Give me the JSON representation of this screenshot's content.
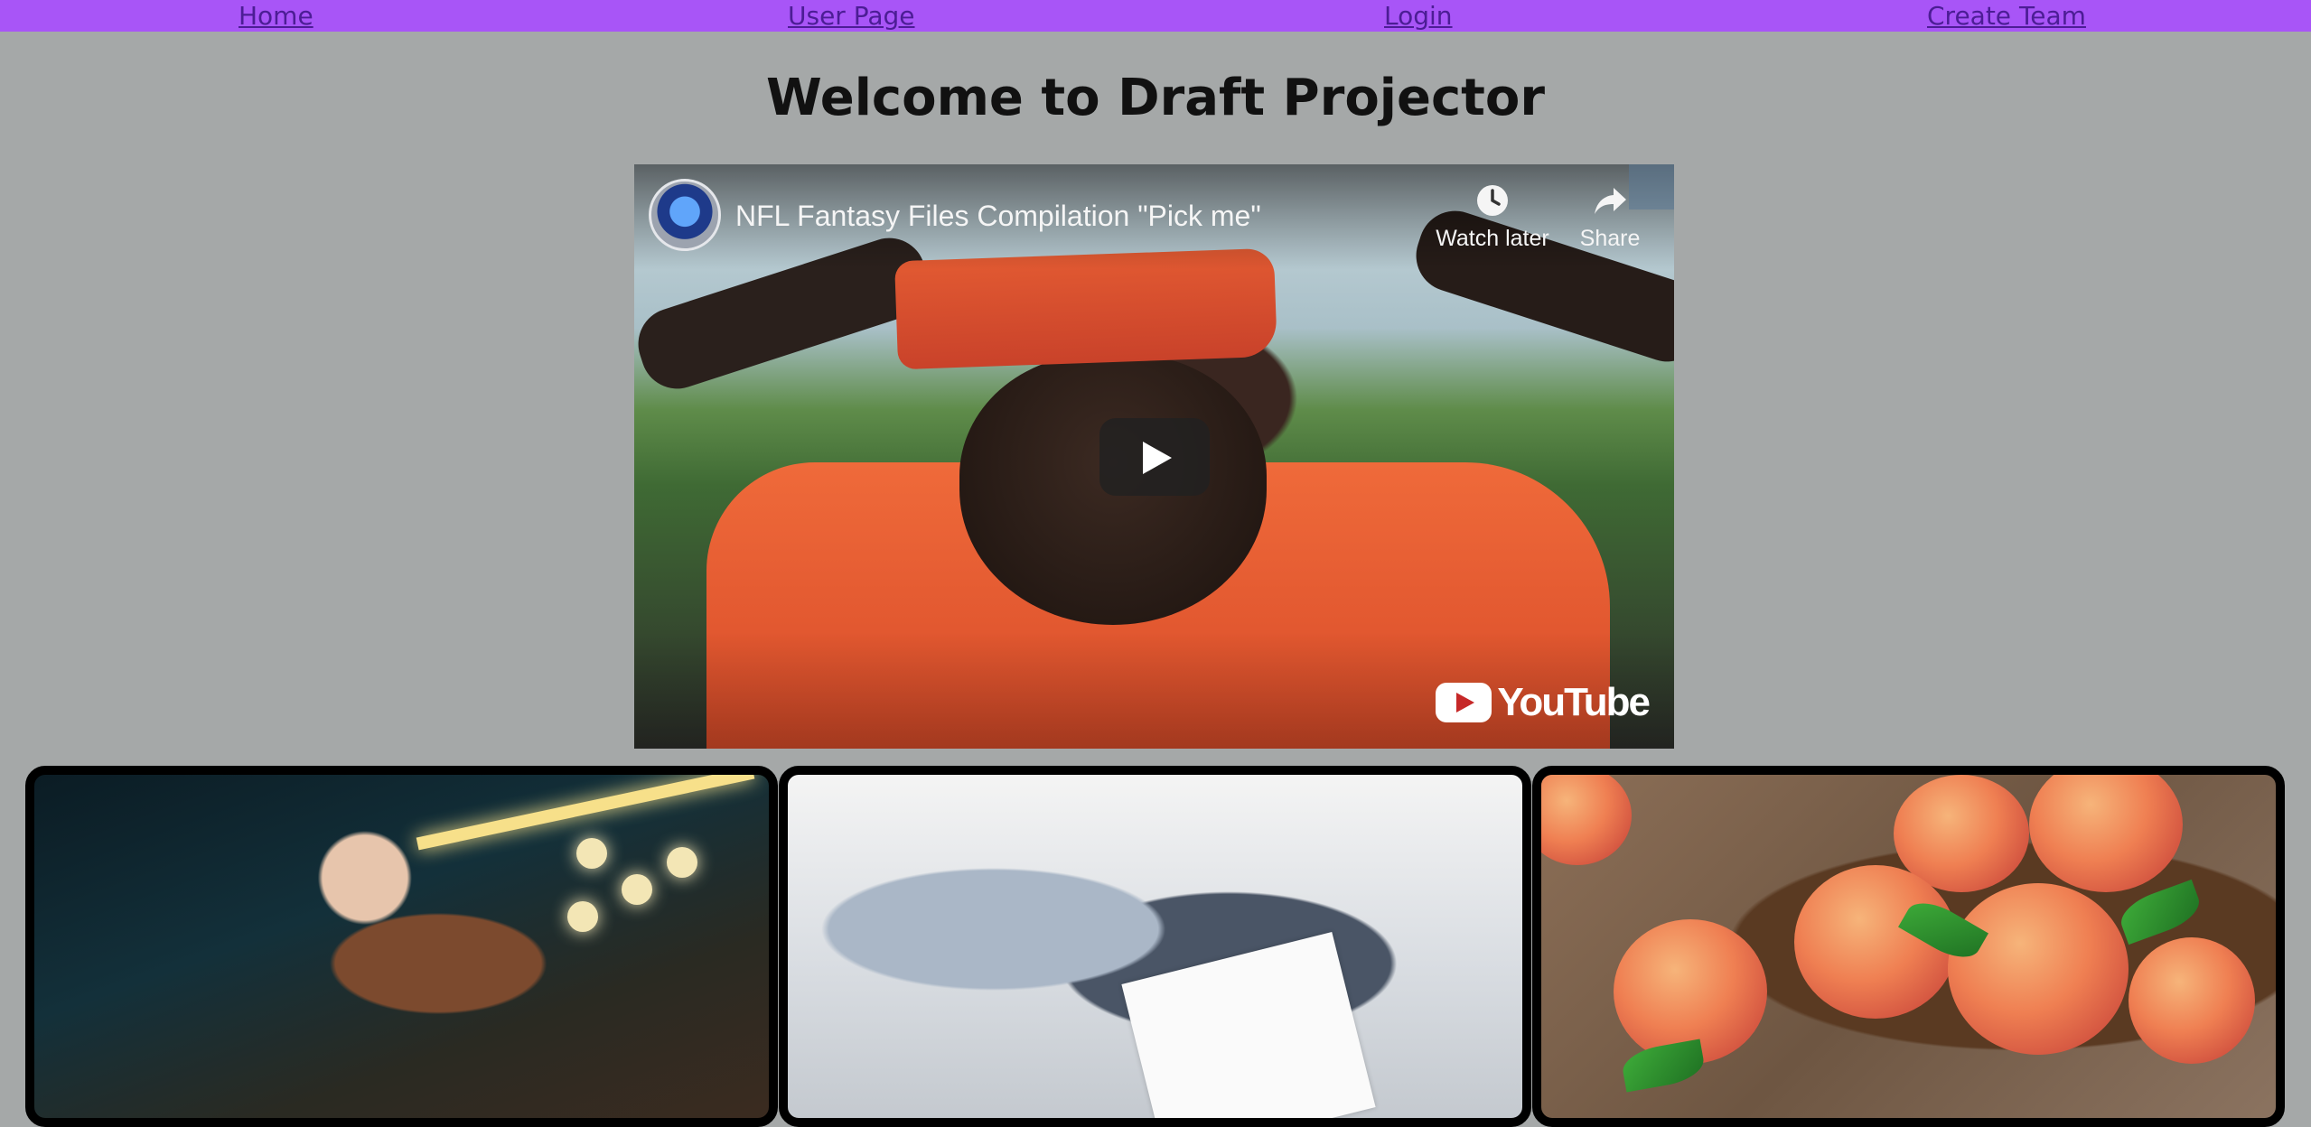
{
  "nav": {
    "home": "Home",
    "user_page": "User Page",
    "login": "Login",
    "create_team": "Create Team"
  },
  "page": {
    "title": "Welcome to Draft Projector"
  },
  "video": {
    "title": "NFL Fantasy Files Compilation \"Pick me\"",
    "watch_later": "Watch later",
    "share": "Share",
    "logo_text": "YouTube"
  },
  "colors": {
    "nav_bg": "#a855f7",
    "page_bg": "#a5a8a8",
    "card_border": "#000000"
  }
}
